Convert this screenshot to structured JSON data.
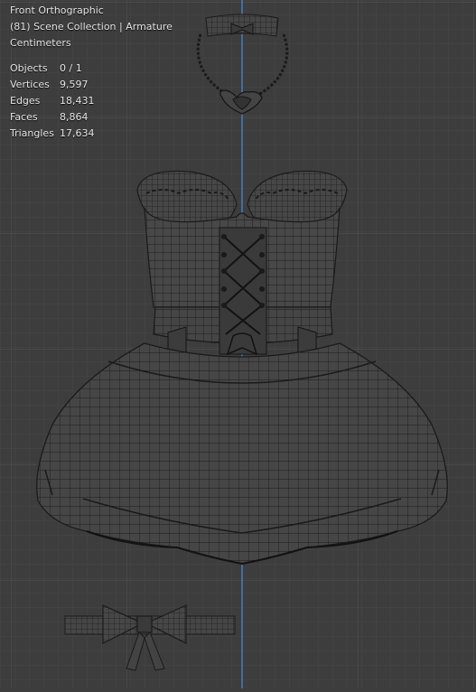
{
  "viewport": {
    "view_name": "Front Orthographic",
    "collection": "(81) Scene Collection | Armature",
    "units": "Centimeters"
  },
  "stats": [
    {
      "label": "Objects",
      "value": "0 / 1"
    },
    {
      "label": "Vertices",
      "value": "9,597"
    },
    {
      "label": "Edges",
      "value": "18,431"
    },
    {
      "label": "Faces",
      "value": "8,864"
    },
    {
      "label": "Triangles",
      "value": "17,634"
    }
  ],
  "colors": {
    "background": "#3d3d3d",
    "grid_minor": "#444444",
    "grid_major": "#4c4c4c",
    "z_axis": "#4a8fd6",
    "wire": "#1a1a1a",
    "mesh_fill": "#4a4a4a"
  }
}
